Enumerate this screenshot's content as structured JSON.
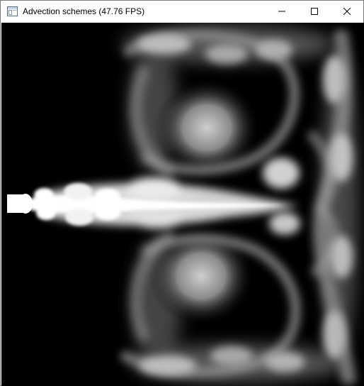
{
  "window": {
    "title": "Advection schemes (47.76 FPS)",
    "controls": {
      "minimize_icon": "minimize-icon",
      "maximize_icon": "maximize-icon",
      "close_icon": "close-icon"
    }
  },
  "canvas": {
    "background": "#000000",
    "smoke_color": "#ffffff",
    "content": "smoke simulation render"
  }
}
